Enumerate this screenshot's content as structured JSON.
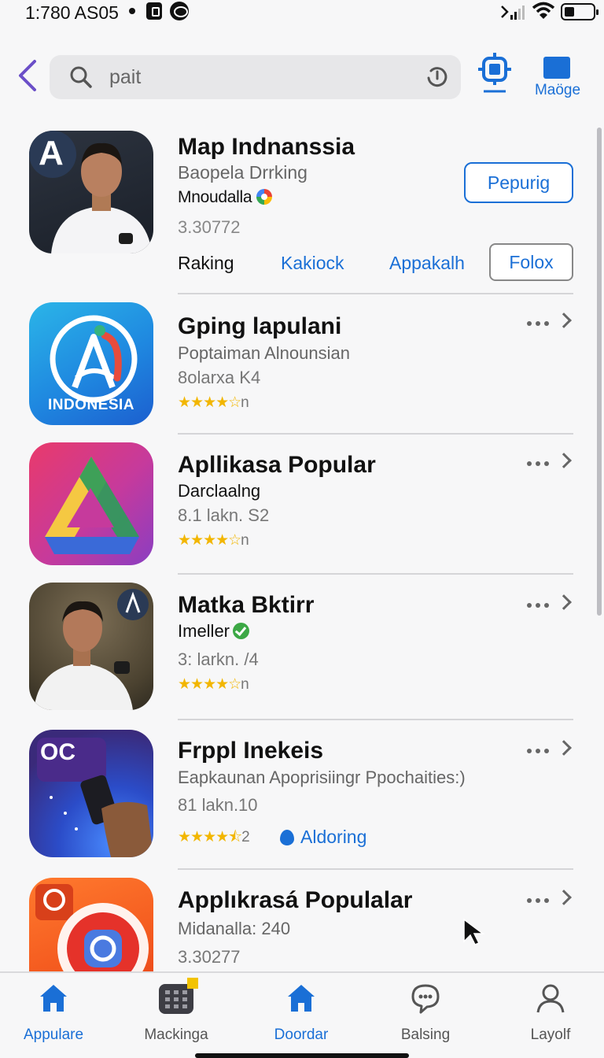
{
  "status_bar": {
    "time": "1:780 AS05",
    "battery_level": 0.35
  },
  "header": {
    "search_value": "pait",
    "manage_label": "Maöge"
  },
  "featured": {
    "title": "Map Indnanssia",
    "subtitle": "Baopela Drrking",
    "developer": "Mnoudalla",
    "number": "3.30772",
    "action_button": "Pepurig",
    "icon_badge_letter": "A",
    "tabs": [
      "Raking",
      "Kakiock",
      "Appakalh"
    ],
    "tab_button": "Folox"
  },
  "items": [
    {
      "title": "Gping lapulani",
      "line2": "Poptaiman Alnounsian",
      "line3": "8olarxa K4",
      "rating": 4,
      "rating_tail": "n",
      "icon": "indonesia-icon",
      "icon_text": "INDONESIA"
    },
    {
      "title": "Apllikasa Popular",
      "line2": "Darclaalng",
      "line3": "8.1 lakn. S2",
      "rating": 4,
      "rating_tail": "n",
      "icon": "triangle-icon"
    },
    {
      "title": "Matka Bktirr",
      "line2": "Imeller",
      "line3": "3: larkn. /4",
      "rating": 4,
      "rating_tail": "n",
      "icon": "person-icon"
    },
    {
      "title": "Frppl Inekeis",
      "line2": "Eapkaunan Apoprisiingr Ppochaities:)",
      "line3": "81 lakn.10",
      "rating": 4.5,
      "rating_tail": "2",
      "tag": "Aldoring",
      "icon": "phone-hand-icon",
      "icon_text": "OC"
    },
    {
      "title": "Applıkrasá Populalar",
      "line2": "Midanalla: 240",
      "line3": "3.30277",
      "icon": "camera-app-icon"
    }
  ],
  "bottom_nav": [
    {
      "label": "Appulare",
      "icon": "home-icon",
      "active": true
    },
    {
      "label": "Mackinga",
      "icon": "calculator-icon",
      "active": false
    },
    {
      "label": "Doordar",
      "icon": "home-icon",
      "active": true
    },
    {
      "label": "Balsing",
      "icon": "chat-bubble-icon",
      "active": false
    },
    {
      "label": "Layolf",
      "icon": "person-icon",
      "active": false
    }
  ],
  "colors": {
    "accent": "#1a6fd6",
    "star": "#f2b600",
    "back_arrow": "#6b4fc8"
  }
}
